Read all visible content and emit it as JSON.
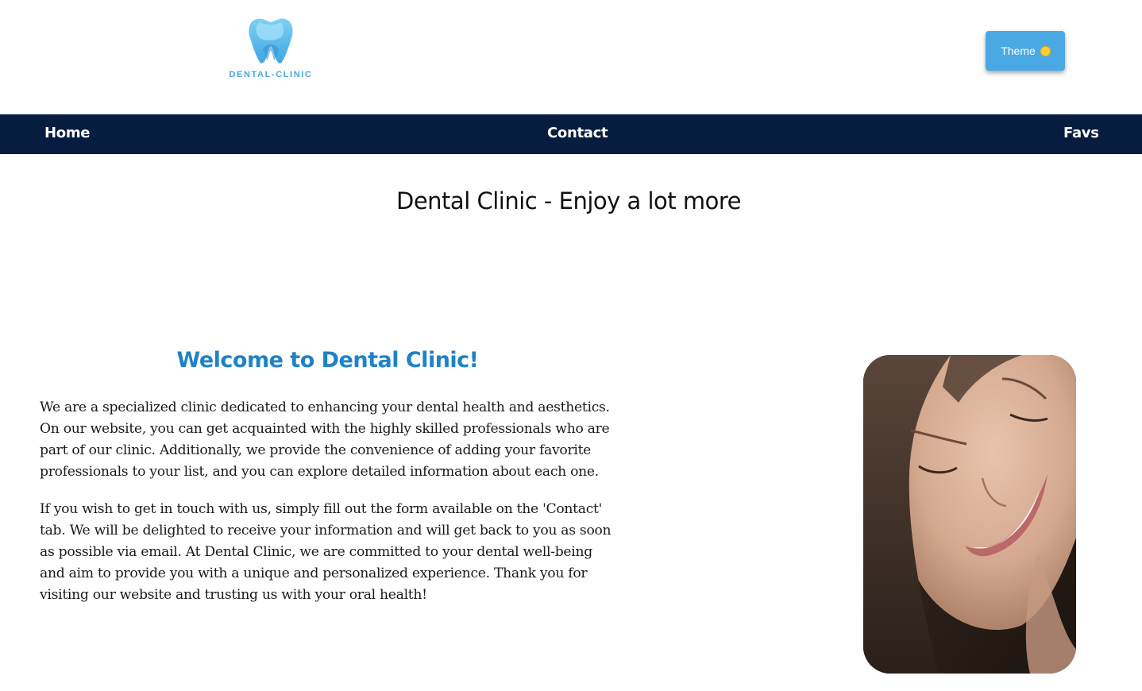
{
  "header": {
    "logo_text": "DENTAL-CLINIC",
    "theme_button_label": "Theme",
    "theme_icon": "sun-icon"
  },
  "nav": {
    "items": [
      {
        "label": "Home"
      },
      {
        "label": "Contact"
      },
      {
        "label": "Favs"
      }
    ]
  },
  "main": {
    "title": "Dental Clinic - Enjoy a lot more",
    "welcome_heading": "Welcome to Dental Clinic!",
    "paragraphs": [
      "We are a specialized clinic dedicated to enhancing your dental health and aesthetics. On our website, you can get acquainted with the highly skilled professionals who are part of our clinic. Additionally, we provide the convenience of adding your favorite professionals to your list, and you can explore detailed information about each one.",
      "If you wish to get in touch with us, simply fill out the form available on the 'Contact' tab. We will be delighted to receive your information and will get back to you as soon as possible via email. At Dental Clinic, we are committed to your dental well-being and aim to provide you with a unique and personalized experience. Thank you for visiting our website and trusting us with your oral health!"
    ]
  },
  "colors": {
    "navbar_bg": "#061d40",
    "accent_blue": "#1f82c6",
    "theme_button_bg": "#4aa8e4",
    "logo_blue": "#4aa6dd"
  }
}
